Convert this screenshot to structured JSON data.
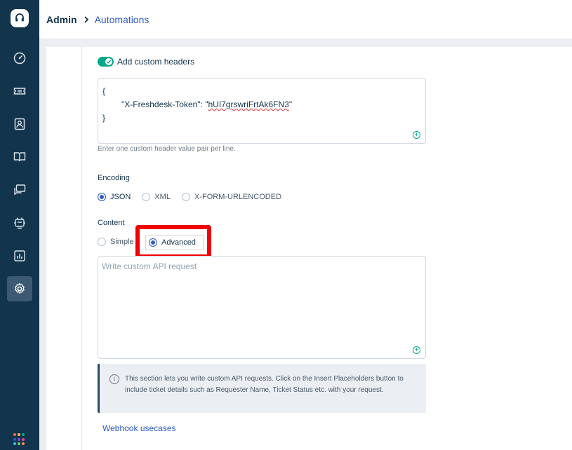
{
  "breadcrumb": {
    "root": "Admin",
    "current": "Automations"
  },
  "sidebar": {
    "items": [
      {
        "icon": "dashboard-icon"
      },
      {
        "icon": "tickets-icon"
      },
      {
        "icon": "contacts-icon"
      },
      {
        "icon": "solutions-icon"
      },
      {
        "icon": "discussions-icon"
      },
      {
        "icon": "freddy-icon"
      },
      {
        "icon": "reports-icon"
      },
      {
        "icon": "admin-gear-icon",
        "active": true
      }
    ],
    "apps_colors": [
      "#f36c5d",
      "#f8b943",
      "#00a886",
      "#2c5cc5",
      "#7d4dcb",
      "#e84393",
      "#36c2d8",
      "#5ad071",
      "#ff8c3a"
    ]
  },
  "custom_headers": {
    "toggle_label": "Add custom headers",
    "enabled": true,
    "line_open": "{",
    "header_key": "\"X-Freshdesk-Token\": \"",
    "header_value": "hUI7grswriFrtAk6FN3",
    "header_close": "\"",
    "line_close": "}",
    "hint": "Enter one custom header value pair per line."
  },
  "encoding": {
    "label": "Encoding",
    "options": [
      "JSON",
      "XML",
      "X-FORM-URLENCODED"
    ],
    "selected": "JSON"
  },
  "content": {
    "label": "Content",
    "options": [
      "Simple",
      "Advanced"
    ],
    "selected": "Advanced"
  },
  "api_request": {
    "placeholder": "Write custom API request"
  },
  "info": {
    "text": "This section lets you write custom API requests. Click on the Insert Placeholders button to include ticket details such as Requester Name, Ticket Status etc. with your request."
  },
  "links": {
    "webhook_usecases": "Webhook usecases"
  },
  "colors": {
    "sidebar": "#12344d",
    "accent": "#2c5cc5",
    "toggle_on": "#00a886",
    "highlight": "#f00000"
  }
}
